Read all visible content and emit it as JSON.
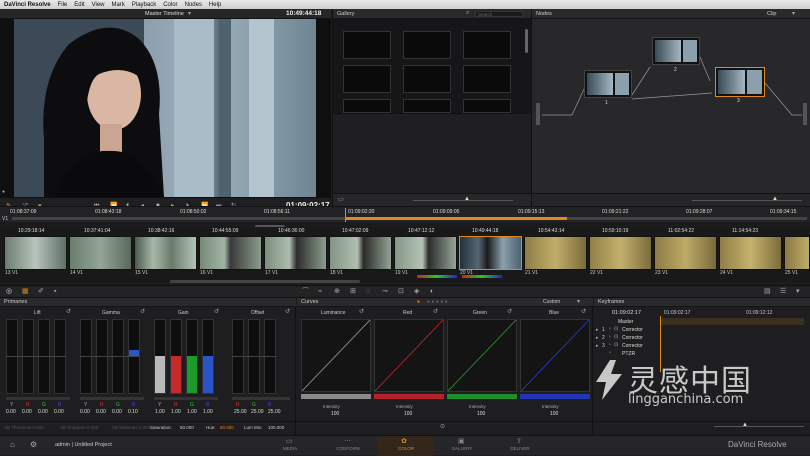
{
  "menubar": {
    "items": [
      "DaVinci Resolve",
      "File",
      "Edit",
      "View",
      "Mark",
      "Playback",
      "Color",
      "Nodes",
      "Help"
    ]
  },
  "viewer": {
    "timeline_name": "Master Timeline",
    "timecode_top": "10:49:44:18",
    "timecode_current": "01:09:02:17"
  },
  "gallery": {
    "title": "Gallery",
    "search_placeholder": "Search"
  },
  "nodes": {
    "title": "Nodes",
    "mode": "Clip",
    "labels": [
      "1",
      "2",
      "3"
    ]
  },
  "timeline": {
    "track": "V1",
    "ruler": [
      "01:08:37:09",
      "01:08:43:18",
      "01:08:50:02",
      "01:08:56:11",
      "01:09:02:20",
      "01:09:09:05",
      "01:09:15:13",
      "01:09:21:22",
      "01:09:28:07",
      "01:09:34:15"
    ],
    "clips": [
      {
        "tc": "10:29:18:14",
        "label": "13 V1"
      },
      {
        "tc": "10:37:41:04",
        "label": "14 V1"
      },
      {
        "tc": "10:38:42:16",
        "label": "15 V1"
      },
      {
        "tc": "10:44:55:09",
        "label": "16 V1"
      },
      {
        "tc": "10:46:36:00",
        "label": "17 V1"
      },
      {
        "tc": "10:47:02:09",
        "label": "18 V1"
      },
      {
        "tc": "10:47:12:12",
        "label": "19 V1"
      },
      {
        "tc": "10:49:44:18",
        "label": "20 V1"
      },
      {
        "tc": "10:54:43:14",
        "label": "21 V1"
      },
      {
        "tc": "10:59:10:19",
        "label": "22 V1"
      },
      {
        "tc": "11:02:54:22",
        "label": "23 V1"
      },
      {
        "tc": "11:14:54:23",
        "label": "24 V1"
      },
      {
        "tc": "",
        "label": "25 V1"
      }
    ]
  },
  "primaries": {
    "title": "Primaries",
    "wheels": [
      {
        "name": "Lift",
        "values": [
          "0.00",
          "0.00",
          "0.00",
          "0.00"
        ],
        "rgb": [
          "Y",
          "R",
          "G",
          "B"
        ]
      },
      {
        "name": "Gamma",
        "values": [
          "0.00",
          "0.00",
          "0.00",
          "0.10"
        ],
        "rgb": [
          "Y",
          "R",
          "G",
          "B"
        ]
      },
      {
        "name": "Gain",
        "values": [
          "1.00",
          "1.00",
          "1.00",
          "1.00"
        ],
        "rgb": [
          "Y",
          "R",
          "G",
          "B"
        ]
      },
      {
        "name": "Offset",
        "values": [
          "25.00",
          "25.00",
          "25.00",
          "25.00"
        ],
        "rgb": [
          "R",
          "G",
          "B"
        ]
      }
    ],
    "footer": {
      "threshold": "SB Threshold  0.000",
      "shadows": "SB Shadows  0.000",
      "midtones": "SB Midtones  0.000",
      "saturation_label": "Saturation:",
      "saturation": "50.000",
      "hue_label": "Hue:",
      "hue": "50.000",
      "lummix_label": "Lum Mix:",
      "lummix": "100.000"
    }
  },
  "curves": {
    "title": "Curves",
    "mode": "Custom",
    "channels": [
      {
        "name": "Luminance",
        "intensity_label": "Intensity",
        "intensity": "100",
        "color": "#9a9a9a"
      },
      {
        "name": "Red",
        "intensity_label": "Intensity",
        "intensity": "100",
        "color": "#c0282a"
      },
      {
        "name": "Green",
        "intensity_label": "Intensity",
        "intensity": "100",
        "color": "#22a02c"
      },
      {
        "name": "Blue",
        "intensity_label": "Intensity",
        "intensity": "100",
        "color": "#2a3cc8"
      }
    ]
  },
  "keyframes": {
    "title": "Keyframes",
    "tc_left": "01:09:02:17",
    "tc_mid": "01:09:02:17",
    "tc_right": "01:09:12:12",
    "master": "Master",
    "rows": [
      {
        "num": "1",
        "label": "Corrector"
      },
      {
        "num": "2",
        "label": "Corrector"
      },
      {
        "num": "3",
        "label": "Corrector"
      },
      {
        "num": "",
        "label": "PTZR"
      }
    ]
  },
  "bottombar": {
    "project": "admin | Untitled Project",
    "pages": [
      "MEDIA",
      "CONFORM",
      "COLOR",
      "GALLERY",
      "DELIVER"
    ],
    "active_page": "COLOR",
    "brand": "DaVinci Resolve"
  },
  "watermark": {
    "cn": "灵感中国",
    "url": "lingganchina.com"
  },
  "colors": {
    "accent": "#e08a1e",
    "active_tab": "#3a2a1a"
  }
}
